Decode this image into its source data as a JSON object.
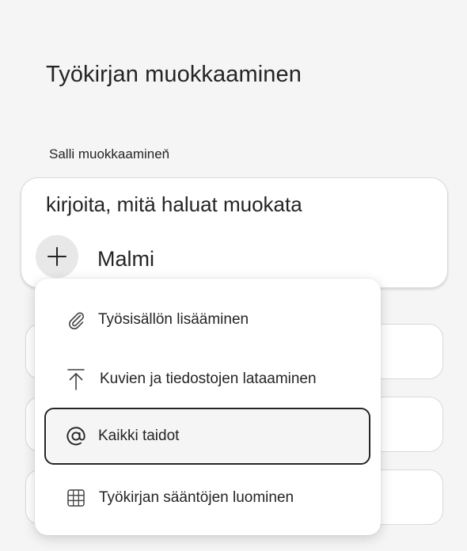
{
  "page": {
    "title": "Työkirjan muokkaaminen",
    "allow_edit_label": "Salli muokkaaminen",
    "allow_edit_chevron": "⌄"
  },
  "prompt": {
    "placeholder": "kirjoita, mitä haluat muokata",
    "model_label": "Malmi",
    "add_icon": "plus-icon"
  },
  "menu": {
    "items": [
      {
        "label": "Työsisällön lisääminen",
        "icon": "paperclip-icon"
      },
      {
        "label": "Kuvien ja tiedostojen lataaminen",
        "icon": "upload-icon"
      },
      {
        "label": "Kaikki taidot",
        "icon": "at-icon",
        "selected": true
      },
      {
        "label": "Työkirjan sääntöjen luominen",
        "icon": "table-grid-icon"
      }
    ]
  },
  "colors": {
    "background": "#f5f5f5",
    "card": "#ffffff",
    "text": "#242424",
    "border": "#d9d9d9",
    "focus_outline": "#242424"
  }
}
